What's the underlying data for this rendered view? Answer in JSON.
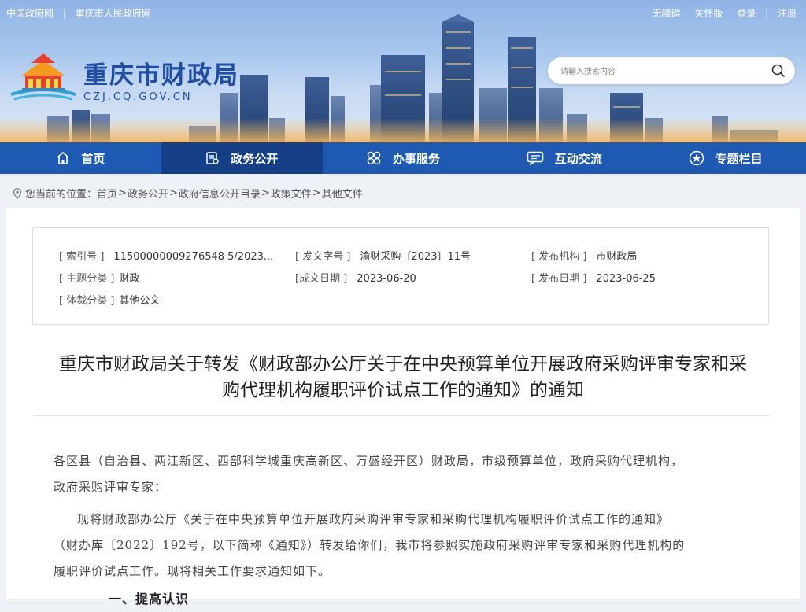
{
  "topbar": {
    "left_links": [
      "中国政府网",
      "重庆市人民政府网"
    ],
    "right_links": [
      "无障碍",
      "关怀版",
      "登录",
      "注册"
    ]
  },
  "site": {
    "title": "重庆市财政局",
    "domain": "CZJ.CQ.GOV.CN"
  },
  "search": {
    "placeholder": "请输入搜索内容",
    "icon": "search-icon"
  },
  "nav": {
    "items": [
      {
        "label": "首页",
        "icon": "home-icon"
      },
      {
        "label": "政务公开",
        "icon": "document-icon",
        "active": true
      },
      {
        "label": "办事服务",
        "icon": "service-icon"
      },
      {
        "label": "互动交流",
        "icon": "chat-icon"
      },
      {
        "label": "专题栏目",
        "icon": "star-icon"
      }
    ]
  },
  "breadcrumb": {
    "prefix": "您当前的位置：",
    "items": [
      "首页",
      "政务公开",
      "政府信息公开目录",
      "政策文件",
      "其他文件"
    ]
  },
  "meta": {
    "index_label": "[ 索引号 ]",
    "index_value": "11500000009276548 5/2023...",
    "docno_label": "[ 发文字号 ]",
    "docno_value": "渝财采购〔2023〕11号",
    "org_label": "[ 发布机构 ]",
    "org_value": "市财政局",
    "topic_label": "[ 主题分类 ]",
    "topic_value": "财政",
    "created_label": "[成文日期 ]",
    "created_value": "2023-06-20",
    "pub_label": "[ 发布日期 ]",
    "pub_value": "2023-06-25",
    "genre_label": "[ 体裁分类 ]",
    "genre_value": "其他公文"
  },
  "document": {
    "title_line1": "重庆市财政局关于转发《财政部办公厅关于在中央预算单位开展政府采购评审专家和采",
    "title_line2": "购代理机构履职评价试点工作的通知》的通知",
    "para1_line1": "各区县（自治县、两江新区、西部科学城重庆高新区、万盛经开区）财政局，市级预算单位，政府采购代理机构，",
    "para1_line2": "政府采购评审专家：",
    "para2_line1": "现将财政部办公厅《关于在中央预算单位开展政府采购评审专家和采购代理机构履职评价试点工作的通知》",
    "para2_line2": "（财办库〔2022〕192号，以下简称《通知》）转发给你们，我市将参照实施政府采购评审专家和采购代理机构的",
    "para2_line3": "履职评价试点工作。现将相关工作要求通知如下。",
    "heading1": "一、提高认识"
  },
  "colors": {
    "nav": "#1e5ab3",
    "nav_active": "#153f86",
    "brand": "#1f4ea3"
  }
}
